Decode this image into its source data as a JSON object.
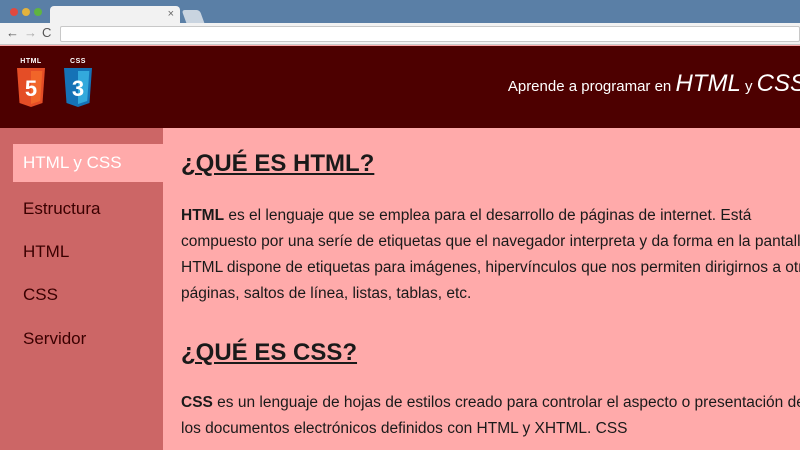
{
  "browser": {
    "tab_close": "×",
    "nav_back": "←",
    "nav_forward": "→",
    "nav_reload": "C"
  },
  "header": {
    "logos": [
      {
        "label": "HTML",
        "glyph": "5",
        "color": "#e44d26"
      },
      {
        "label": "CSS",
        "glyph": "3",
        "color": "#1572b6"
      }
    ],
    "tagline_prefix": "Aprende a programar en ",
    "tagline_html": "HTML",
    "tagline_and": " y ",
    "tagline_css": "CSS"
  },
  "sidebar": {
    "items": [
      {
        "label": "HTML y CSS",
        "active": true
      },
      {
        "label": "Estructura",
        "active": false
      },
      {
        "label": "HTML",
        "active": false
      },
      {
        "label": "CSS",
        "active": false
      },
      {
        "label": "Servidor",
        "active": false
      }
    ]
  },
  "main": {
    "sections": [
      {
        "heading": "¿QUÉ ES HTML?",
        "lead": "HTML",
        "body": " es el lenguaje que se emplea para el desarrollo de páginas de internet. Está compuesto por una seríe de etiquetas que el navegador interpreta y da forma en la pantalla. HTML dispone de etiquetas para imágenes, hipervínculos que nos permiten dirigirnos a otras páginas, saltos de línea, listas, tablas, etc."
      },
      {
        "heading": "¿QUÉ ES CSS?",
        "lead": "CSS",
        "body": " es un lenguaje de hojas de estilos creado para controlar el aspecto o presentación de los documentos electrónicos definidos con HTML y XHTML. CSS"
      }
    ]
  },
  "colors": {
    "header_bg": "#4d0000",
    "sidebar_bg": "#cc6666",
    "content_bg": "#ffaaaa"
  }
}
